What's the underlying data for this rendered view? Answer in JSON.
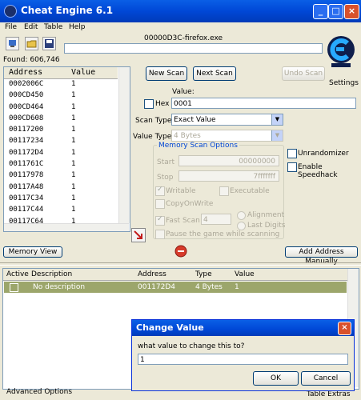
{
  "window": {
    "title": "Cheat Engine 6.1"
  },
  "menu": [
    "File",
    "Edit",
    "Table",
    "Help"
  ],
  "process_name": "00000D3C-firefox.exe",
  "found": "Found: 606,746",
  "settings_label": "Settings",
  "address_list": {
    "col_address": "Address",
    "col_value": "Value",
    "rows": [
      {
        "address": "0002006C",
        "value": "1"
      },
      {
        "address": "000CD450",
        "value": "1"
      },
      {
        "address": "000CD464",
        "value": "1"
      },
      {
        "address": "000CD608",
        "value": "1"
      },
      {
        "address": "00117200",
        "value": "1"
      },
      {
        "address": "00117234",
        "value": "1"
      },
      {
        "address": "001172D4",
        "value": "1"
      },
      {
        "address": "0011761C",
        "value": "1"
      },
      {
        "address": "00117978",
        "value": "1"
      },
      {
        "address": "00117A48",
        "value": "1"
      },
      {
        "address": "00117C34",
        "value": "1"
      },
      {
        "address": "00117C44",
        "value": "1"
      },
      {
        "address": "00117C64",
        "value": "1"
      }
    ]
  },
  "scan": {
    "new_scan": "New Scan",
    "next_scan": "Next Scan",
    "undo_scan": "Undo Scan",
    "value_label": "Value:",
    "hex_label": "Hex",
    "value_input": "0001",
    "scan_type_label": "Scan Type",
    "scan_type_value": "Exact Value",
    "value_type_label": "Value Type",
    "value_type_value": "4 Bytes"
  },
  "options": {
    "title": "Memory Scan Options",
    "start_label": "Start",
    "start_value": "00000000",
    "stop_label": "Stop",
    "stop_value": "7fffffff",
    "writable": "Writable",
    "executable": "Executable",
    "copy_on_write": "CopyOnWrite",
    "fast_scan": "Fast Scan",
    "fast_scan_value": "4",
    "alignment": "Alignment",
    "last_digits": "Last Digits",
    "pause": "Pause the game while scanning"
  },
  "unrandomizer": "Unrandomizer",
  "speedhack": "Enable Speedhack",
  "memory_view": "Memory View",
  "add_address": "Add Address Manually",
  "table": {
    "headers": [
      "Active",
      "Description",
      "Address",
      "Type",
      "Value"
    ],
    "rows": [
      {
        "description": "No description",
        "address": "001172D4",
        "type": "4 Bytes",
        "value": "1"
      }
    ]
  },
  "advanced_options": "Advanced Options",
  "table_extras": "Table Extras",
  "dialog": {
    "title": "Change Value",
    "prompt": "what value to change this to?",
    "input": "1",
    "ok": "OK",
    "cancel": "Cancel"
  },
  "colors": {
    "title_blue": "#0047d6",
    "selected_row": "#9ca66b",
    "close_red": "#d8512c"
  }
}
